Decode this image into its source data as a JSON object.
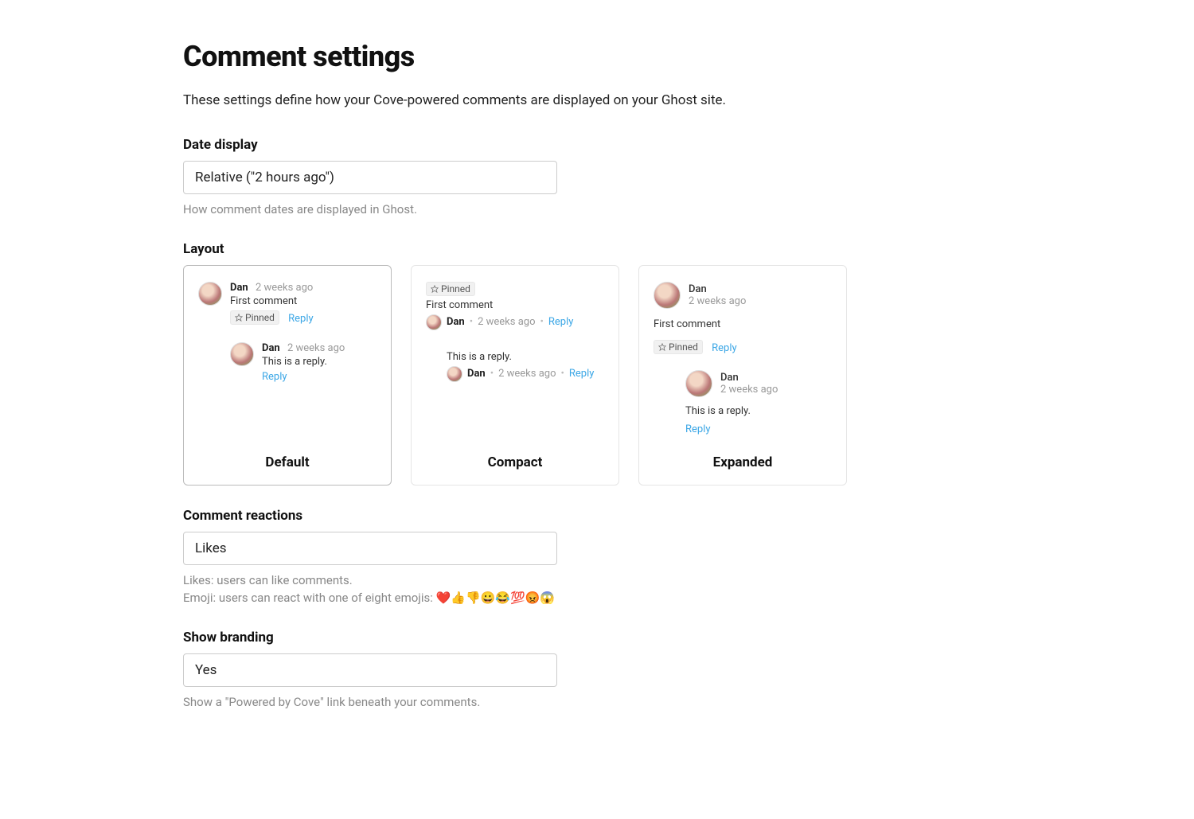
{
  "page": {
    "title": "Comment settings",
    "intro": "These settings define how your Cove-powered comments are displayed on your Ghost site."
  },
  "date_display": {
    "label": "Date display",
    "value": "Relative (\"2 hours ago\")",
    "help": "How comment dates are displayed in Ghost."
  },
  "layout": {
    "label": "Layout",
    "selected": "Default",
    "options": {
      "default": {
        "title": "Default",
        "author": "Dan",
        "time": "2 weeks ago",
        "text": "First comment",
        "pinned": "Pinned",
        "reply": "Reply",
        "reply_author": "Dan",
        "reply_time": "2 weeks ago",
        "reply_text": "This is a reply.",
        "reply_reply": "Reply"
      },
      "compact": {
        "title": "Compact",
        "pinned": "Pinned",
        "text": "First comment",
        "author": "Dan",
        "time": "2 weeks ago",
        "reply": "Reply",
        "reply_text": "This is a reply.",
        "reply_author": "Dan",
        "reply_time": "2 weeks ago",
        "reply_reply": "Reply"
      },
      "expanded": {
        "title": "Expanded",
        "author": "Dan",
        "time": "2 weeks ago",
        "text": "First comment",
        "pinned": "Pinned",
        "reply": "Reply",
        "reply_author": "Dan",
        "reply_time": "2 weeks ago",
        "reply_text": "This is a reply.",
        "reply_reply": "Reply"
      }
    }
  },
  "reactions": {
    "label": "Comment reactions",
    "value": "Likes",
    "help_line1": "Likes: users can like comments.",
    "help_line2": "Emoji: users can react with one of eight emojis: ❤️👍👎😀😂💯😡😱"
  },
  "branding": {
    "label": "Show branding",
    "value": "Yes",
    "help": "Show a \"Powered by Cove\" link beneath your comments."
  }
}
